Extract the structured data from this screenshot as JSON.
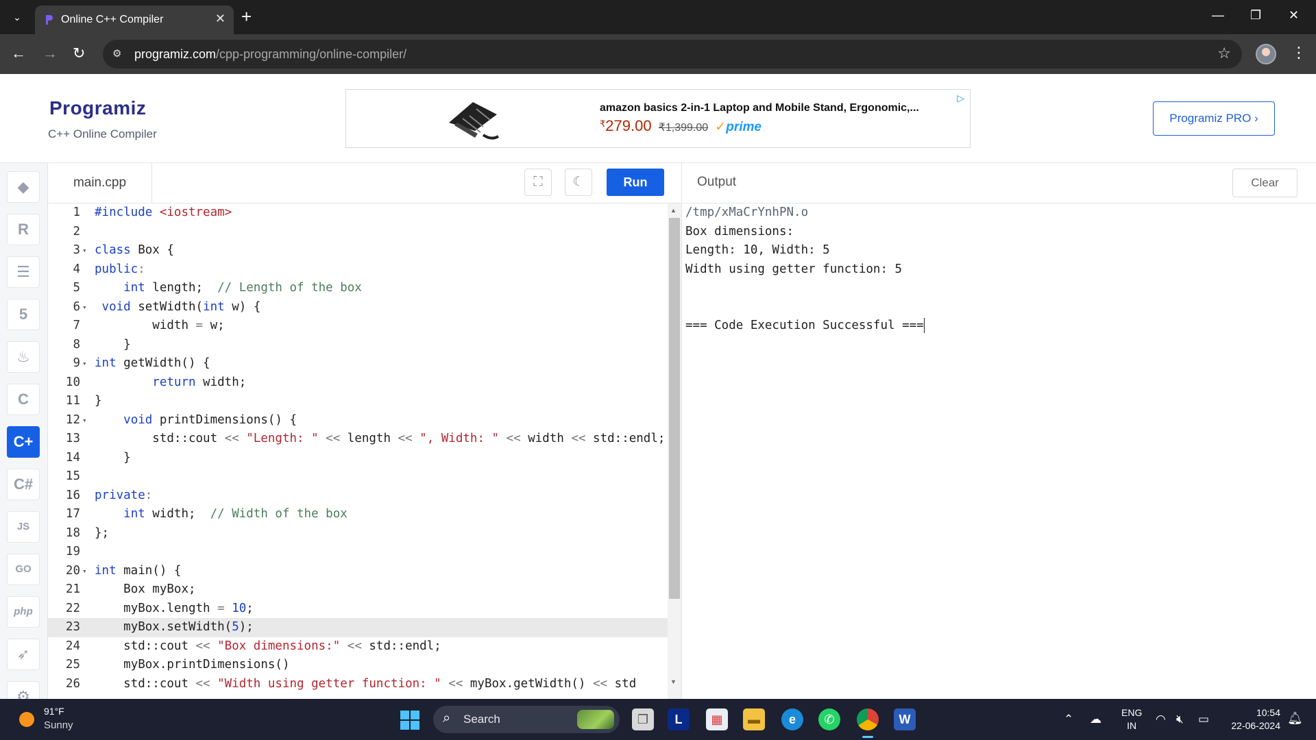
{
  "browser": {
    "tab_title": "Online C++ Compiler",
    "tab_close": "✕",
    "new_tab": "+",
    "url_host": "programiz.com",
    "url_path": "/cpp-programming/online-compiler/"
  },
  "site": {
    "logo": "Programiz",
    "subtitle": "C++ Online Compiler",
    "pro_button": "Programiz PRO ›"
  },
  "ad": {
    "title": "amazon basics 2-in-1 Laptop and Mobile Stand, Ergonomic,...",
    "currency": "₹",
    "price": "279.00",
    "old_price": "₹1,399.00",
    "prime": "prime"
  },
  "languages": [
    "python",
    "r",
    "sql",
    "html",
    "java",
    "c",
    "cpp",
    "csharp",
    "js",
    "go",
    "php",
    "swift",
    "rust"
  ],
  "editor": {
    "file_name": "main.cpp",
    "run_label": "Run",
    "current_line": 23
  },
  "code_lines": [
    {
      "n": "1",
      "fold": false
    },
    {
      "n": "2",
      "fold": false
    },
    {
      "n": "3",
      "fold": true
    },
    {
      "n": "4",
      "fold": false
    },
    {
      "n": "5",
      "fold": false
    },
    {
      "n": "6",
      "fold": true
    },
    {
      "n": "7",
      "fold": false
    },
    {
      "n": "8",
      "fold": false
    },
    {
      "n": "9",
      "fold": true
    },
    {
      "n": "10",
      "fold": false
    },
    {
      "n": "11",
      "fold": false
    },
    {
      "n": "12",
      "fold": true
    },
    {
      "n": "13",
      "fold": false
    },
    {
      "n": "14",
      "fold": false
    },
    {
      "n": "15",
      "fold": false
    },
    {
      "n": "16",
      "fold": false
    },
    {
      "n": "17",
      "fold": false
    },
    {
      "n": "18",
      "fold": false
    },
    {
      "n": "19",
      "fold": false
    },
    {
      "n": "20",
      "fold": true
    },
    {
      "n": "21",
      "fold": false
    },
    {
      "n": "22",
      "fold": false
    },
    {
      "n": "23",
      "fold": false
    },
    {
      "n": "24",
      "fold": false
    },
    {
      "n": "25",
      "fold": false
    },
    {
      "n": "26",
      "fold": false
    }
  ],
  "code": {
    "l1_kw": "#include",
    "l1_str": "<iostream>",
    "l3_kw": "class",
    "l3_rest": " Box {",
    "l4_kw": "public",
    "l5_kw": "int",
    "l5_rest": " length;  ",
    "l5_com": "// Length of the box",
    "l6_kw": "void",
    "l6_a": " setWidth(",
    "l6_kw2": "int",
    "l6_b": " w) {",
    "l7_a": "width ",
    "l7_op": "=",
    "l7_b": " w;",
    "l8": "}",
    "l9_kw": "int",
    "l9_rest": " getWidth() {",
    "l10_kw": "return",
    "l10_rest": " width;",
    "l11": "}",
    "l12_kw": "void",
    "l12_rest": " printDimensions() {",
    "l13_a": "std::cout ",
    "l13_op1": "<<",
    "l13_str1": " \"Length: \" ",
    "l13_op2": "<<",
    "l13_b": " length ",
    "l13_op3": "<<",
    "l13_str2": " \", Width: \" ",
    "l13_op4": "<<",
    "l13_c": " width ",
    "l13_op5": "<<",
    "l13_d": " std::endl;",
    "l14": "}",
    "l16_kw": "private",
    "l17_kw": "int",
    "l17_rest": " width;  ",
    "l17_com": "// Width of the box",
    "l18": "};",
    "l20_kw": "int",
    "l20_rest": " main() {",
    "l21": "Box myBox;",
    "l22_a": "myBox.length ",
    "l22_op": "=",
    "l22_num": " 10",
    "l22_b": ";",
    "l23_a": "myBox.setWidth(",
    "l23_num": "5",
    "l23_b": ");",
    "l24_a": "std::cout ",
    "l24_op1": "<<",
    "l24_str": " \"Box dimensions:\" ",
    "l24_op2": "<<",
    "l24_b": " std::endl;",
    "l25": "myBox.printDimensions()",
    "l26_a": "std::cout ",
    "l26_op1": "<<",
    "l26_str": " \"Width using getter function: \" ",
    "l26_op2": "<<",
    "l26_b": " myBox.getWidth() ",
    "l26_op3": "<<",
    "l26_c": " std"
  },
  "output": {
    "label": "Output",
    "clear_label": "Clear",
    "lines": [
      "/tmp/xMaCrYnhPN.o",
      "Box dimensions:",
      "Length: 10, Width: 5",
      "Width using getter function: 5",
      "",
      "",
      "=== Code Execution Successful ==="
    ]
  },
  "taskbar": {
    "temperature": "91°F",
    "condition": "Sunny",
    "search_placeholder": "Search",
    "lang_top": "ENG",
    "lang_bottom": "IN",
    "time": "10:54",
    "date": "22-06-2024"
  },
  "colors": {
    "accent": "#1660e4",
    "chrome_dark": "#1f1f1f",
    "taskbar": "#1c2030"
  }
}
